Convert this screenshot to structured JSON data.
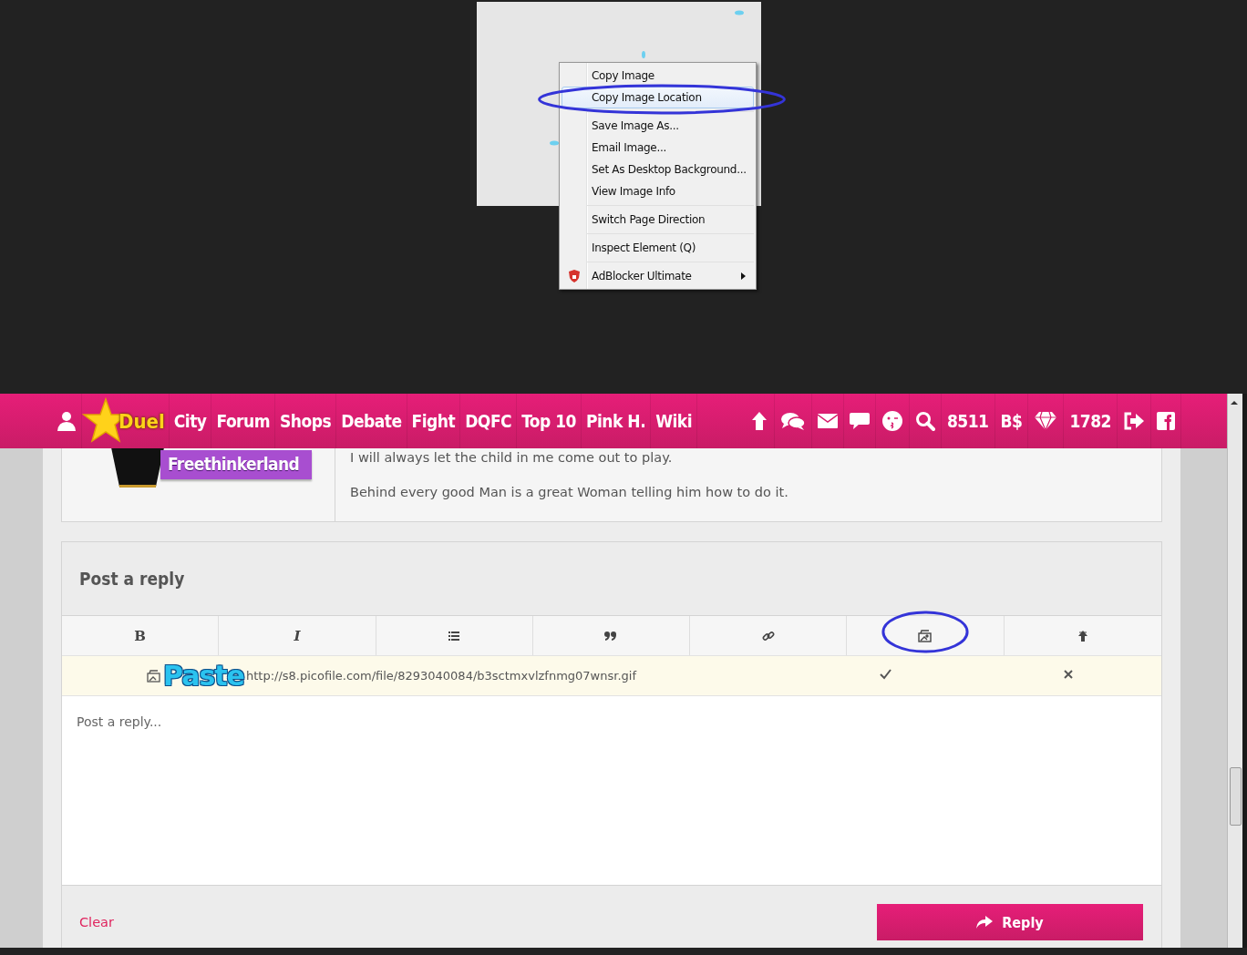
{
  "context_menu": {
    "groups": [
      [
        {
          "label": "Copy Image",
          "highlighted": false,
          "circled": false,
          "submenu": false,
          "shield_icon": false
        },
        {
          "label": "Copy Image Location",
          "highlighted": true,
          "circled": true,
          "submenu": false,
          "shield_icon": false
        }
      ],
      [
        {
          "label": "Save Image As...",
          "highlighted": false,
          "circled": false,
          "submenu": false,
          "shield_icon": false
        },
        {
          "label": "Email Image...",
          "highlighted": false,
          "circled": false,
          "submenu": false,
          "shield_icon": false
        },
        {
          "label": "Set As Desktop Background...",
          "highlighted": false,
          "circled": false,
          "submenu": false,
          "shield_icon": false
        },
        {
          "label": "View Image Info",
          "highlighted": false,
          "circled": false,
          "submenu": false,
          "shield_icon": false
        }
      ],
      [
        {
          "label": "Switch Page Direction",
          "highlighted": false,
          "circled": false,
          "submenu": false,
          "shield_icon": false
        }
      ],
      [
        {
          "label": "Inspect Element (Q)",
          "highlighted": false,
          "circled": false,
          "submenu": false,
          "shield_icon": false
        }
      ],
      [
        {
          "label": "AdBlocker Ultimate",
          "highlighted": false,
          "circled": false,
          "submenu": true,
          "shield_icon": true
        }
      ]
    ]
  },
  "navbar": {
    "logo_text": "Duel",
    "links": [
      "City",
      "Forum",
      "Shops",
      "Debate",
      "Fight",
      "DQFC",
      "Top 10",
      "Pink H.",
      "Wiki"
    ],
    "right_items": [
      {
        "kind": "upload"
      },
      {
        "kind": "chats"
      },
      {
        "kind": "mail"
      },
      {
        "kind": "comment"
      },
      {
        "kind": "emoji"
      },
      {
        "kind": "search"
      },
      {
        "kind": "count",
        "text": "8511"
      },
      {
        "kind": "currency",
        "text": "B$"
      },
      {
        "kind": "diamond"
      },
      {
        "kind": "count",
        "text": "1782"
      },
      {
        "kind": "logout"
      },
      {
        "kind": "facebook"
      }
    ]
  },
  "signature": {
    "badge_text": "Freethinkerland",
    "lines": [
      "I will always let the child in me come out to play.",
      "Behind every good Man is a great Woman telling him how to do it."
    ]
  },
  "reply_form": {
    "title": "Post a reply",
    "toolbar": [
      {
        "kind": "bold",
        "label": "B",
        "circled": false
      },
      {
        "kind": "italic",
        "label": "I",
        "circled": false
      },
      {
        "kind": "list",
        "circled": false
      },
      {
        "kind": "quote",
        "circled": false
      },
      {
        "kind": "link",
        "circled": false
      },
      {
        "kind": "image",
        "circled": true
      },
      {
        "kind": "upload",
        "circled": false
      }
    ],
    "url_row": {
      "annotation": "Paste",
      "value": "http://s8.picofile.com/file/8293040084/b3sctmxvlzfnmg07wnsr.gif"
    },
    "placeholder": "Post a reply...",
    "clear": "Clear",
    "submit": "Reply"
  }
}
